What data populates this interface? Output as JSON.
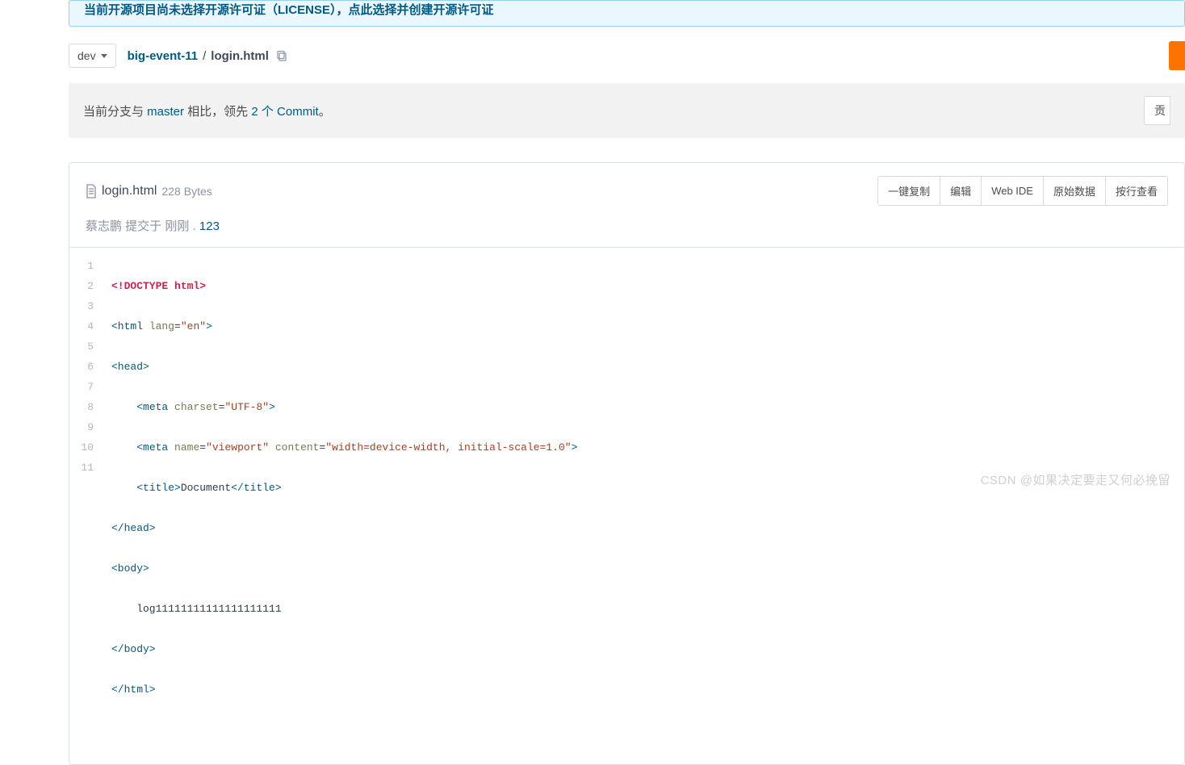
{
  "notice": {
    "text": "当前开源项目尚未选择开源许可证（LICENSE），点此选择并创建开源许可证"
  },
  "branch": {
    "label": "dev"
  },
  "breadcrumb": {
    "repo": "big-event-11",
    "sep": "/",
    "file": "login.html"
  },
  "compare": {
    "prefix": "当前分支与 ",
    "base": "master",
    "mid": " 相比，领先 ",
    "commits": "2 个 Commit",
    "suffix": "。",
    "right_btn": "贡"
  },
  "file": {
    "name": "login.html",
    "size": "228 Bytes"
  },
  "actions": {
    "copy": "一键复制",
    "edit": "编辑",
    "webide": "Web IDE",
    "raw": "原始数据",
    "blame": "按行查看"
  },
  "commit": {
    "author": "蔡志鹏",
    "verb": " 提交于 ",
    "time": "刚刚",
    "dot": " . ",
    "msg": "123"
  },
  "code": {
    "lines": [
      {
        "n": "1"
      },
      {
        "n": "2"
      },
      {
        "n": "3"
      },
      {
        "n": "4"
      },
      {
        "n": "5"
      },
      {
        "n": "6"
      },
      {
        "n": "7"
      },
      {
        "n": "8"
      },
      {
        "n": "9"
      },
      {
        "n": "10"
      },
      {
        "n": "11"
      }
    ],
    "l1": "<!DOCTYPE html>",
    "l2_open": "<html",
    "l2_attr": " lang",
    "l2_eq": "=",
    "l2_val": "\"en\"",
    "l2_close": ">",
    "l3": "<head>",
    "l4_open": "<meta",
    "l4_attr": " charset",
    "l4_eq": "=",
    "l4_val": "\"UTF-8\"",
    "l4_close": ">",
    "l5_open": "<meta",
    "l5_a1": " name",
    "l5_e1": "=",
    "l5_v1": "\"viewport\"",
    "l5_a2": " content",
    "l5_e2": "=",
    "l5_v2": "\"width=device-width, initial-scale=1.0\"",
    "l5_close": ">",
    "l6_o": "<title>",
    "l6_t": "Document",
    "l6_c": "</title>",
    "l7": "</head>",
    "l8": "<body>",
    "l9": "    log11111111111111111111",
    "l10": "</body>",
    "l11": "</html>"
  },
  "watermark": "CSDN @如果决定要走又何必挽留"
}
